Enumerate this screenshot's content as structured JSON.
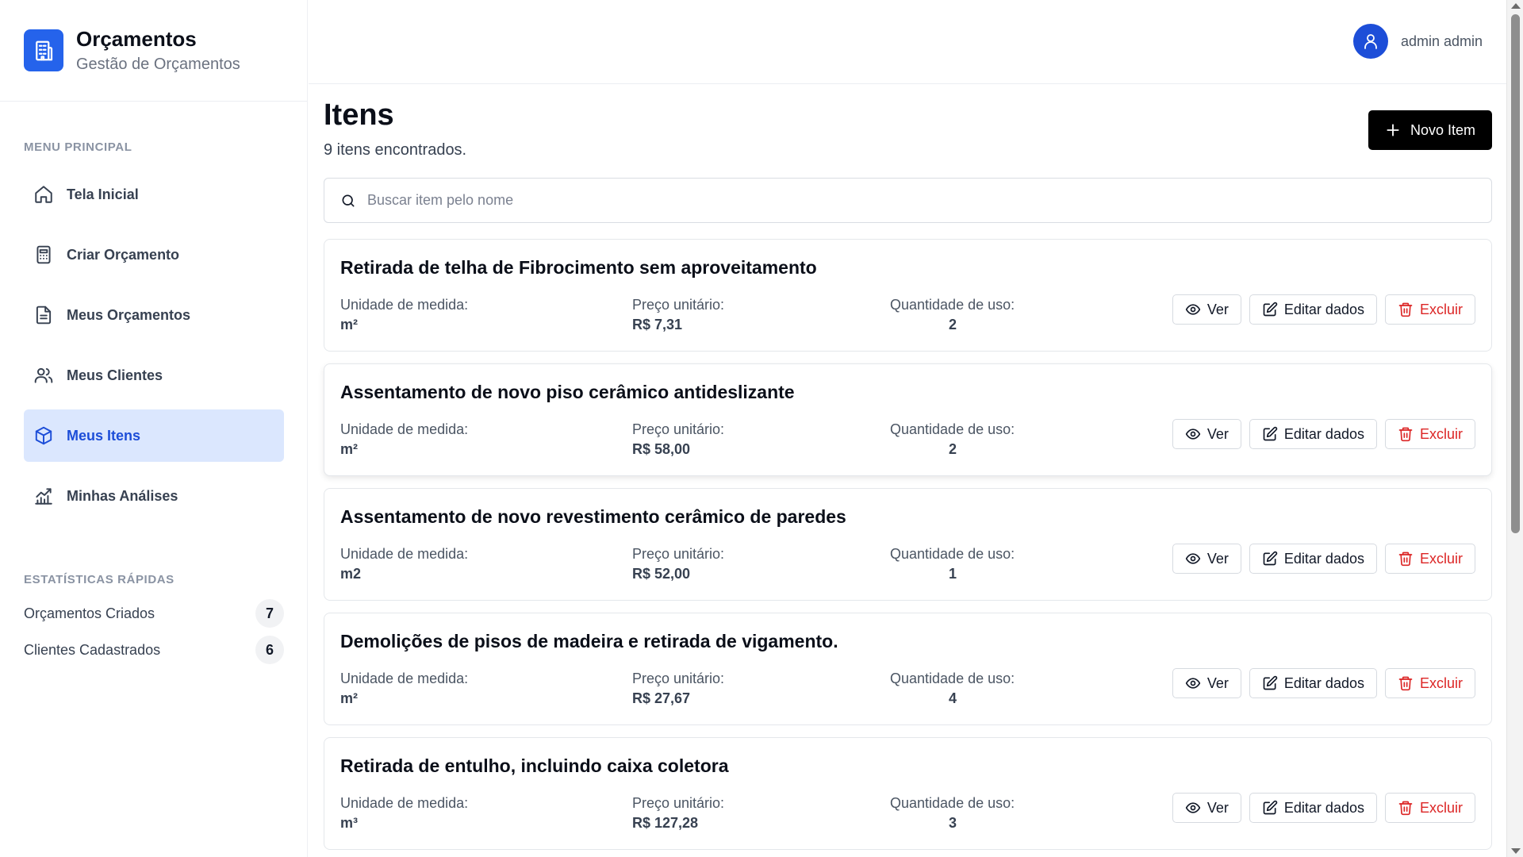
{
  "brand": {
    "title": "Orçamentos",
    "subtitle": "Gestão de Orçamentos",
    "icon": "building-icon"
  },
  "sidebar": {
    "menu_label": "MENU PRINCIPAL",
    "items": [
      {
        "label": "Tela Inicial",
        "icon": "home-icon"
      },
      {
        "label": "Criar Orçamento",
        "icon": "calculator-icon"
      },
      {
        "label": "Meus Orçamentos",
        "icon": "document-icon"
      },
      {
        "label": "Meus Clientes",
        "icon": "users-icon"
      },
      {
        "label": "Meus Itens",
        "icon": "box-icon",
        "active": true
      },
      {
        "label": "Minhas Análises",
        "icon": "chart-icon"
      }
    ],
    "stats_label": "ESTATÍSTICAS RÁPIDAS",
    "stats": [
      {
        "label": "Orçamentos Criados",
        "value": "7"
      },
      {
        "label": "Clientes Cadastrados",
        "value": "6"
      }
    ]
  },
  "header": {
    "user_name": "admin admin",
    "icon": "user-icon"
  },
  "main": {
    "title": "Itens",
    "count_text": "9 itens encontrados.",
    "new_button": "Novo Item",
    "search_placeholder": "Buscar item pelo nome",
    "field_labels": {
      "unit": "Unidade de medida:",
      "price": "Preço unitário:",
      "usage": "Quantidade de uso:"
    },
    "actions": {
      "view": "Ver",
      "edit": "Editar dados",
      "delete": "Excluir"
    },
    "items": [
      {
        "name": "Retirada de telha de Fibrocimento sem aproveitamento",
        "unit": "m²",
        "price": "R$ 7,31",
        "usage": "2"
      },
      {
        "name": "Assentamento de novo piso cerâmico antideslizante",
        "unit": "m²",
        "price": "R$ 58,00",
        "usage": "2"
      },
      {
        "name": "Assentamento de novo revestimento cerâmico de paredes",
        "unit": "m2",
        "price": "R$ 52,00",
        "usage": "1"
      },
      {
        "name": "Demolições de pisos de madeira e retirada de vigamento.",
        "unit": "m²",
        "price": "R$ 27,67",
        "usage": "4"
      },
      {
        "name": "Retirada de entulho, incluindo caixa coletora",
        "unit": "m³",
        "price": "R$ 127,28",
        "usage": "3"
      }
    ]
  },
  "colors": {
    "primary": "#2563eb",
    "active_bg": "#dbe7fe",
    "danger": "#dc2626"
  }
}
